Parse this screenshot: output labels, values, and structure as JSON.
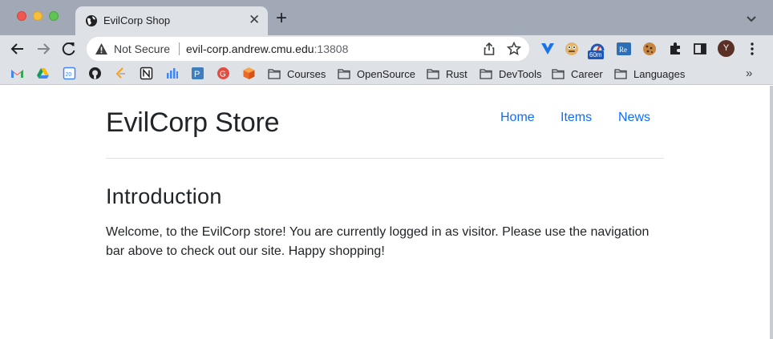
{
  "browser": {
    "tab": {
      "title": "EvilCorp Shop"
    },
    "address": {
      "security_label": "Not Secure",
      "url_host": "evil-corp.andrew.cmu.edu",
      "url_port": ":13808"
    },
    "extension_badge": "60m",
    "profile_initial": "Y",
    "bookmarks": {
      "folders": [
        "Courses",
        "OpenSource",
        "Rust",
        "DevTools",
        "Career",
        "Languages"
      ],
      "more": "»"
    }
  },
  "site": {
    "brand": "EvilCorp Store",
    "nav": [
      "Home",
      "Items",
      "News"
    ],
    "section_title": "Introduction",
    "intro": "Welcome, to the EvilCorp store! You are currently logged in as visitor. Please use the navigation bar above to check out our site. Happy shopping!"
  },
  "colors": {
    "link": "#0d6efd",
    "text": "#212529",
    "chrome_frame": "#a2a9b6",
    "chrome_toolbar": "#dee1e6"
  }
}
